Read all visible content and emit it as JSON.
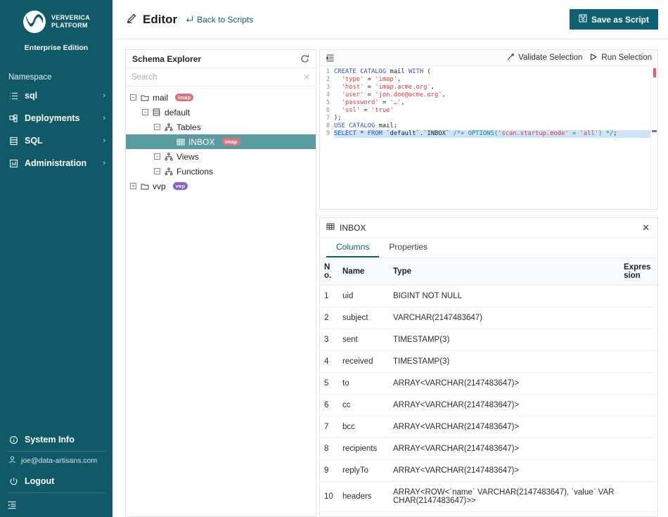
{
  "sidebar": {
    "brand": {
      "line1": "VERVERICA",
      "line2": "PLATFORM",
      "edition": "Enterprise Edition",
      "logo_icon": "ververica-logo-icon"
    },
    "namespace_label": "Namespace",
    "items": [
      {
        "label": "sql",
        "icon": "list-icon",
        "chevron": "›"
      },
      {
        "label": "Deployments",
        "icon": "deployments-icon",
        "chevron": "›"
      },
      {
        "label": "SQL",
        "icon": "database-icon",
        "chevron": "›"
      },
      {
        "label": "Administration",
        "icon": "administration-icon",
        "chevron": "›"
      }
    ],
    "system_info": {
      "label": "System Info",
      "icon": "info-icon"
    },
    "user": {
      "email": "joe@data-artisans.com",
      "icon": "user-icon"
    },
    "logout": {
      "label": "Logout",
      "icon": "power-icon"
    },
    "collapse": {
      "icon": "collapse-sidebar-icon"
    },
    "bg_color": "#105a68"
  },
  "topbar": {
    "title": "Editor",
    "title_icon": "pencil-icon",
    "back_link": "Back to Scripts",
    "back_icon": "back-arrow-icon",
    "save_button": {
      "label": "Save as Script",
      "icon": "save-disk-icon",
      "color": "#0d6170"
    }
  },
  "schema_explorer": {
    "title": "Schema Explorer",
    "refresh_icon": "refresh-icon",
    "search": {
      "value": "",
      "placeholder": "Search",
      "clear_icon": "clear-x-icon"
    },
    "tree": [
      {
        "depth": 0,
        "toggle": "−",
        "icon": "folder-icon",
        "label": "mail",
        "badge": "imap",
        "badge_kind": "imap",
        "selected": false
      },
      {
        "depth": 1,
        "toggle": "−",
        "icon": "database-icon",
        "label": "default",
        "badge": "",
        "badge_kind": "",
        "selected": false
      },
      {
        "depth": 2,
        "toggle": "−",
        "icon": "schema-icon",
        "label": "Tables",
        "badge": "",
        "badge_kind": "",
        "selected": false
      },
      {
        "depth": 3,
        "toggle": "",
        "icon": "table-icon",
        "label": "INBOX",
        "badge": "imap",
        "badge_kind": "imap",
        "selected": true
      },
      {
        "depth": 2,
        "toggle": "−",
        "icon": "schema-icon",
        "label": "Views",
        "badge": "",
        "badge_kind": "",
        "selected": false
      },
      {
        "depth": 2,
        "toggle": "−",
        "icon": "schema-icon",
        "label": "Functions",
        "badge": "",
        "badge_kind": "",
        "selected": false
      },
      {
        "depth": 0,
        "toggle": "+",
        "icon": "folder-icon",
        "label": "vvp",
        "badge": "vvp",
        "badge_kind": "vvp",
        "selected": false
      }
    ]
  },
  "editor": {
    "format_icon": "format-code-icon",
    "validate_button": {
      "label": "Validate Selection",
      "icon": "wand-icon"
    },
    "run_button": {
      "label": "Run Selection",
      "icon": "play-icon"
    },
    "lines": [
      {
        "no": "1",
        "selected": false,
        "text": "CREATE CATALOG mail WITH ("
      },
      {
        "no": "2",
        "selected": false,
        "text": "  'type' = 'imap',"
      },
      {
        "no": "3",
        "selected": false,
        "text": "  'host' = 'imap.acme.org',"
      },
      {
        "no": "4",
        "selected": false,
        "text": "  'user' = 'jon.doe@acme.org',"
      },
      {
        "no": "5",
        "selected": false,
        "text": "  'password' = '…',"
      },
      {
        "no": "6",
        "selected": false,
        "text": "  'ssl' = 'true'"
      },
      {
        "no": "7",
        "selected": false,
        "text": ");"
      },
      {
        "no": "8",
        "selected": false,
        "text": "USE CATALOG mail;"
      },
      {
        "no": "9",
        "selected": true,
        "text": "SELECT * FROM `default`.`INBOX` /*+ OPTIONS('scan.startup.mode' = 'all') */;"
      }
    ]
  },
  "details": {
    "title": "INBOX",
    "title_icon": "table-icon",
    "close_icon": "close-x-icon",
    "tabs": [
      {
        "label": "Columns",
        "active": true
      },
      {
        "label": "Properties",
        "active": false
      }
    ],
    "headers": [
      "No.",
      "Name",
      "Type",
      "Expression"
    ],
    "rows": [
      {
        "no": "1",
        "name": "uid",
        "type": "BIGINT NOT NULL",
        "expression": ""
      },
      {
        "no": "2",
        "name": "subject",
        "type": "VARCHAR(2147483647)",
        "expression": ""
      },
      {
        "no": "3",
        "name": "sent",
        "type": "TIMESTAMP(3)",
        "expression": ""
      },
      {
        "no": "4",
        "name": "received",
        "type": "TIMESTAMP(3)",
        "expression": ""
      },
      {
        "no": "5",
        "name": "to",
        "type": "ARRAY<VARCHAR(2147483647)>",
        "expression": ""
      },
      {
        "no": "6",
        "name": "cc",
        "type": "ARRAY<VARCHAR(2147483647)>",
        "expression": ""
      },
      {
        "no": "7",
        "name": "bcc",
        "type": "ARRAY<VARCHAR(2147483647)>",
        "expression": ""
      },
      {
        "no": "8",
        "name": "recipients",
        "type": "ARRAY<VARCHAR(2147483647)>",
        "expression": ""
      },
      {
        "no": "9",
        "name": "replyTo",
        "type": "ARRAY<VARCHAR(2147483647)>",
        "expression": ""
      },
      {
        "no": "10",
        "name": "headers",
        "type": "ARRAY<ROW<`name` VARCHAR(2147483647), `value` VARCHAR(2147483647)>>",
        "expression": ""
      }
    ]
  }
}
